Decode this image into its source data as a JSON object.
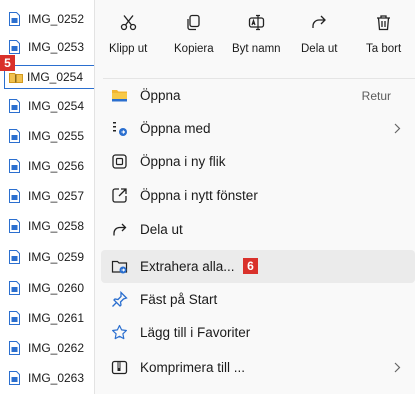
{
  "files": [
    {
      "name": "IMG_0252"
    },
    {
      "name": "IMG_0253"
    },
    {
      "name": "IMG_0254",
      "selected": true
    },
    {
      "name": "IMG_0254"
    },
    {
      "name": "IMG_0255"
    },
    {
      "name": "IMG_0256"
    },
    {
      "name": "IMG_0257"
    },
    {
      "name": "IMG_0258"
    },
    {
      "name": "IMG_0259"
    },
    {
      "name": "IMG_0260"
    },
    {
      "name": "IMG_0261"
    },
    {
      "name": "IMG_0262"
    },
    {
      "name": "IMG_0263"
    }
  ],
  "badges": {
    "step5": "5",
    "step6": "6"
  },
  "toolbar": {
    "cut": "Klipp ut",
    "copy": "Kopiera",
    "rename": "Byt namn",
    "share": "Dela ut",
    "delete": "Ta bort"
  },
  "menu": {
    "open": "Öppna",
    "open_shortcut": "Retur",
    "open_with": "Öppna med",
    "open_new_tab": "Öppna i ny flik",
    "open_new_window": "Öppna i nytt fönster",
    "share": "Dela ut",
    "extract_all": "Extrahera alla...",
    "pin_start": "Fäst på Start",
    "add_favorites": "Lägg till i Favoriter",
    "compress": "Komprimera till ..."
  },
  "colors": {
    "accent": "#2b6fcf",
    "badge": "#d9312b",
    "menu_bg": "#f9f9f9",
    "hover": "#ebebeb"
  }
}
